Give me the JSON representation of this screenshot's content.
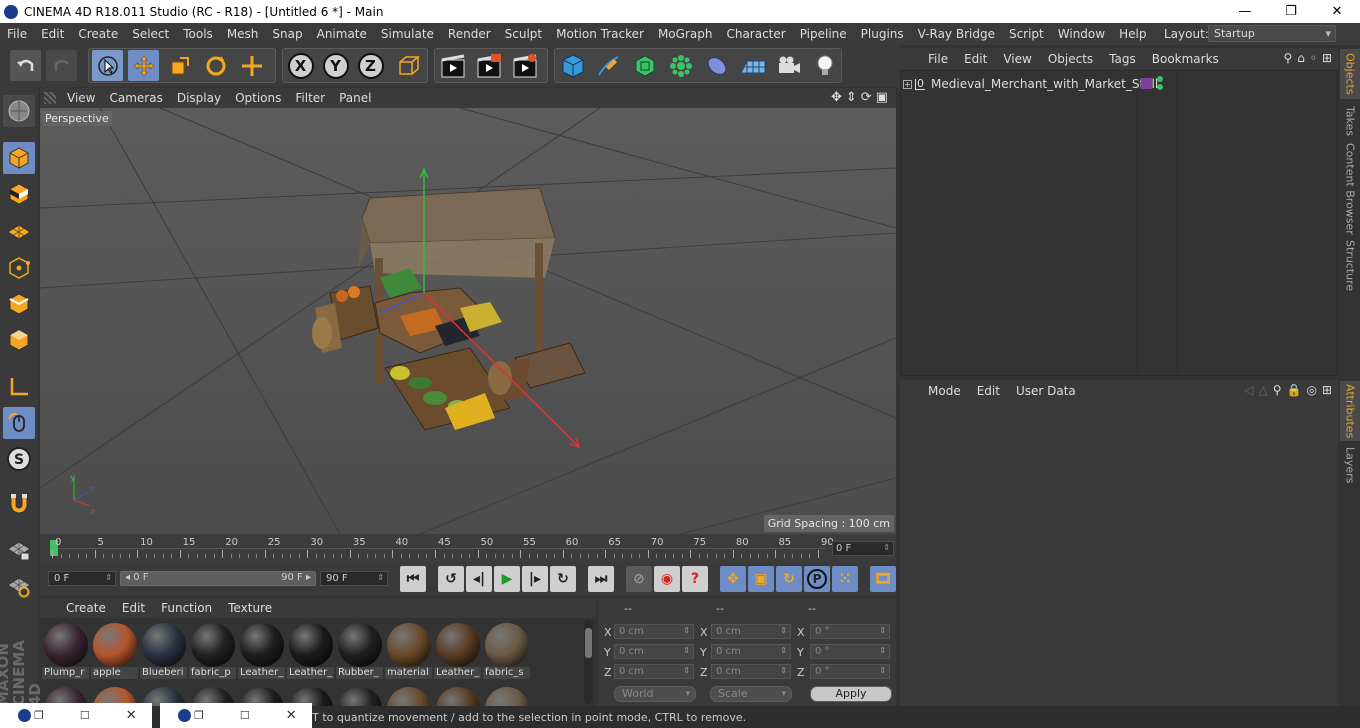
{
  "titlebar": {
    "title": "CINEMA 4D R18.011 Studio (RC - R18) - [Untitled 6 *] - Main",
    "minimize": "—",
    "maximize": "❐",
    "close": "✕"
  },
  "menubar": {
    "items": [
      "File",
      "Edit",
      "Create",
      "Select",
      "Tools",
      "Mesh",
      "Snap",
      "Animate",
      "Simulate",
      "Render",
      "Sculpt",
      "Motion Tracker",
      "MoGraph",
      "Character",
      "Pipeline",
      "Plugins",
      "V-Ray Bridge",
      "Script",
      "Window",
      "Help"
    ],
    "layout_label": "Layout:",
    "layout_value": "Startup"
  },
  "axis_buttons": {
    "x": "X",
    "y": "Y",
    "z": "Z"
  },
  "viewport": {
    "menu": [
      "View",
      "Cameras",
      "Display",
      "Options",
      "Filter",
      "Panel"
    ],
    "label": "Perspective",
    "grid_spacing": "Grid Spacing : 100 cm"
  },
  "timeline": {
    "ticks": [
      "0",
      "5",
      "10",
      "15",
      "20",
      "25",
      "30",
      "35",
      "40",
      "45",
      "50",
      "55",
      "60",
      "65",
      "70",
      "75",
      "80",
      "85",
      "90"
    ],
    "current_frame": "0 F"
  },
  "transport": {
    "start_field": "0 F",
    "range_start": "0 F",
    "range_end": "90 F",
    "end_field": "90 F",
    "param_button": "P"
  },
  "material_manager": {
    "menu": [
      "Create",
      "Edit",
      "Function",
      "Texture"
    ],
    "materials": [
      {
        "label": "Plump_r",
        "color": "#3a2530"
      },
      {
        "label": "apple",
        "color": "#b5562e"
      },
      {
        "label": "Blueberi",
        "color": "#2a3142"
      },
      {
        "label": "fabric_p",
        "color": "#222222"
      },
      {
        "label": "Leather_",
        "color": "#1e1e1e"
      },
      {
        "label": "Leather_",
        "color": "#1c1c1c"
      },
      {
        "label": "Rubber_",
        "color": "#202020"
      },
      {
        "label": "material",
        "color": "#6a4a2a"
      },
      {
        "label": "Leather_",
        "color": "#5a3c22"
      },
      {
        "label": "fabric_s",
        "color": "#6b5a45"
      }
    ]
  },
  "coordinates": {
    "headers": [
      "--",
      "--",
      "--"
    ],
    "rows": [
      {
        "axis": "X",
        "pos": "0 cm",
        "size_axis": "X",
        "size": "0 cm",
        "rot_axis": "X",
        "rot": "0 °"
      },
      {
        "axis": "Y",
        "pos": "0 cm",
        "size_axis": "Y",
        "size": "0 cm",
        "rot_axis": "Y",
        "rot": "0 °"
      },
      {
        "axis": "Z",
        "pos": "0 cm",
        "size_axis": "Z",
        "size": "0 cm",
        "rot_axis": "Z",
        "rot": "0 °"
      }
    ],
    "world": "World",
    "scale": "Scale",
    "apply": "Apply"
  },
  "object_manager": {
    "menu": [
      "File",
      "Edit",
      "View",
      "Objects",
      "Tags",
      "Bookmarks"
    ],
    "objects": [
      {
        "name": "Medieval_Merchant_with_Market_Stall"
      }
    ]
  },
  "attributes": {
    "menu": [
      "Mode",
      "Edit",
      "User Data"
    ]
  },
  "right_tabs": [
    "Objects",
    "Takes",
    "Content Browser",
    "Structure",
    "Attributes",
    "Layers"
  ],
  "statusbar": {
    "text": "FT to quantize movement / add to the selection in point mode, CTRL to remove."
  },
  "logo": {
    "line1": "MAXON",
    "line2": "CINEMA 4D"
  }
}
